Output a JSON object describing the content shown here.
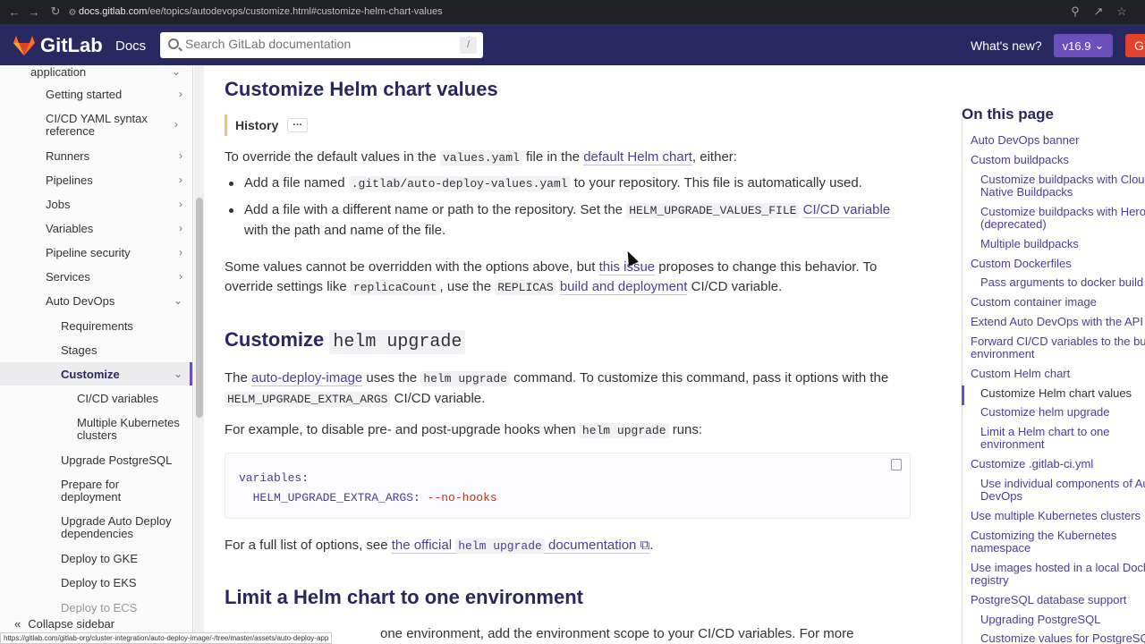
{
  "browser": {
    "url_host": "docs.gitlab.com",
    "url_path": "/ee/topics/autodevops/customize.html#customize-helm-chart-values"
  },
  "header": {
    "logo_text": "GitLab",
    "docs_label": "Docs",
    "search_placeholder": "Search GitLab documentation",
    "search_shortcut": "/",
    "whats_new": "What's new?",
    "version": "v16.9",
    "cta_partial": "G"
  },
  "sidebar": {
    "top_partial": "application",
    "items": [
      {
        "label": "Getting started"
      },
      {
        "label": "CI/CD YAML syntax reference"
      },
      {
        "label": "Runners"
      },
      {
        "label": "Pipelines"
      },
      {
        "label": "Jobs"
      },
      {
        "label": "Variables"
      },
      {
        "label": "Pipeline security"
      },
      {
        "label": "Services"
      },
      {
        "label": "Auto DevOps"
      },
      {
        "label": "Requirements"
      },
      {
        "label": "Stages"
      },
      {
        "label": "Customize"
      },
      {
        "label": "CI/CD variables"
      },
      {
        "label": "Multiple Kubernetes clusters"
      },
      {
        "label": "Upgrade PostgreSQL"
      },
      {
        "label": "Prepare for deployment"
      },
      {
        "label": "Upgrade Auto Deploy dependencies"
      },
      {
        "label": "Deploy to GKE"
      },
      {
        "label": "Deploy to EKS"
      },
      {
        "label": "Deploy to ECS"
      }
    ],
    "collapse_label": "Collapse sidebar",
    "status_url": "https://gitlab.com/gitlab-org/cluster-integration/auto-deploy-image/-/tree/master/assets/auto-deploy-app"
  },
  "content": {
    "h_values": "Customize Helm chart values",
    "history_label": "History",
    "history_more": "···",
    "p1_a": "To override the default values in the ",
    "p1_code": "values.yaml",
    "p1_b": " file in the ",
    "p1_link": "default Helm chart",
    "p1_c": ", either:",
    "li1_a": "Add a file named ",
    "li1_code": ".gitlab/auto-deploy-values.yaml",
    "li1_b": " to your repository. This file is automatically used.",
    "li2_a": "Add a file with a different name or path to the repository. Set the ",
    "li2_code": "HELM_UPGRADE_VALUES_FILE",
    "li2_link": "CI/CD variable",
    "li2_b": "with the path and name of the file.",
    "p2_a": "Some values cannot be overridden with the options above, but ",
    "p2_link1": "this issue",
    "p2_b": " proposes to change this behavior. To override settings like ",
    "p2_code1": "replicaCount",
    "p2_c": ", use the ",
    "p2_code2": "REPLICAS",
    "p2_link2": "build and deployment",
    "p2_d": " CI/CD variable.",
    "h_upgrade_a": "Customize ",
    "h_upgrade_code": "helm upgrade",
    "p3_a": "The ",
    "p3_link": "auto-deploy-image",
    "p3_b": " uses the ",
    "p3_code1": "helm upgrade",
    "p3_c": " command. To customize this command, pass it options with the ",
    "p3_code2": "HELM_UPGRADE_EXTRA_ARGS",
    "p3_d": " CI/CD variable.",
    "p4_a": "For example, to disable pre- and post-upgrade hooks when ",
    "p4_code": "helm upgrade",
    "p4_b": " runs:",
    "code_line1_key": "variables",
    "code_line2_key": "HELM_UPGRADE_EXTRA_ARGS",
    "code_line2_val": "--no-hooks",
    "p5_a": "For a full list of options, see ",
    "p5_link1": "the official",
    "p5_code": "helm upgrade",
    "p5_link2": "documentation",
    "p5_b": ".",
    "h_limit": "Limit a Helm chart to one environment",
    "p6_visible": "one environment, add the environment scope to your CI/CD variables. For more"
  },
  "toc": {
    "title": "On this page",
    "items": [
      {
        "label": "Auto DevOps banner",
        "level": 1
      },
      {
        "label": "Custom buildpacks",
        "level": 1
      },
      {
        "label": "Customize buildpacks with Cloud",
        "level": 2
      },
      {
        "label": "Native Buildpacks",
        "level": 2
      },
      {
        "label": "Customize buildpacks with Heroku",
        "level": 2
      },
      {
        "label": "(deprecated)",
        "level": 2
      },
      {
        "label": "Multiple buildpacks",
        "level": 2
      },
      {
        "label": "Custom Dockerfiles",
        "level": 1
      },
      {
        "label": "Pass arguments to docker build",
        "level": 2
      },
      {
        "label": "Custom container image",
        "level": 1
      },
      {
        "label": "Extend Auto DevOps with the API",
        "level": 1
      },
      {
        "label": "Forward CI/CD variables to the build",
        "level": 1
      },
      {
        "label": "environment",
        "level": 1
      },
      {
        "label": "Custom Helm chart",
        "level": 1
      },
      {
        "label": "Customize Helm chart values",
        "level": 2
      },
      {
        "label": "Customize helm upgrade",
        "level": 2
      },
      {
        "label": "Limit a Helm chart to one",
        "level": 2
      },
      {
        "label": "environment",
        "level": 2
      },
      {
        "label": "Customize .gitlab-ci.yml",
        "level": 1
      },
      {
        "label": "Use individual components of Auto",
        "level": 2
      },
      {
        "label": "DevOps",
        "level": 2
      },
      {
        "label": "Use multiple Kubernetes clusters",
        "level": 1
      },
      {
        "label": "Customizing the Kubernetes",
        "level": 1
      },
      {
        "label": "namespace",
        "level": 1
      },
      {
        "label": "Use images hosted in a local Docker",
        "level": 1
      },
      {
        "label": "registry",
        "level": 1
      },
      {
        "label": "PostgreSQL database support",
        "level": 1
      },
      {
        "label": "Upgrading PostgreSQL",
        "level": 2
      },
      {
        "label": "Customize values for PostgreSQL",
        "level": 2
      }
    ]
  }
}
